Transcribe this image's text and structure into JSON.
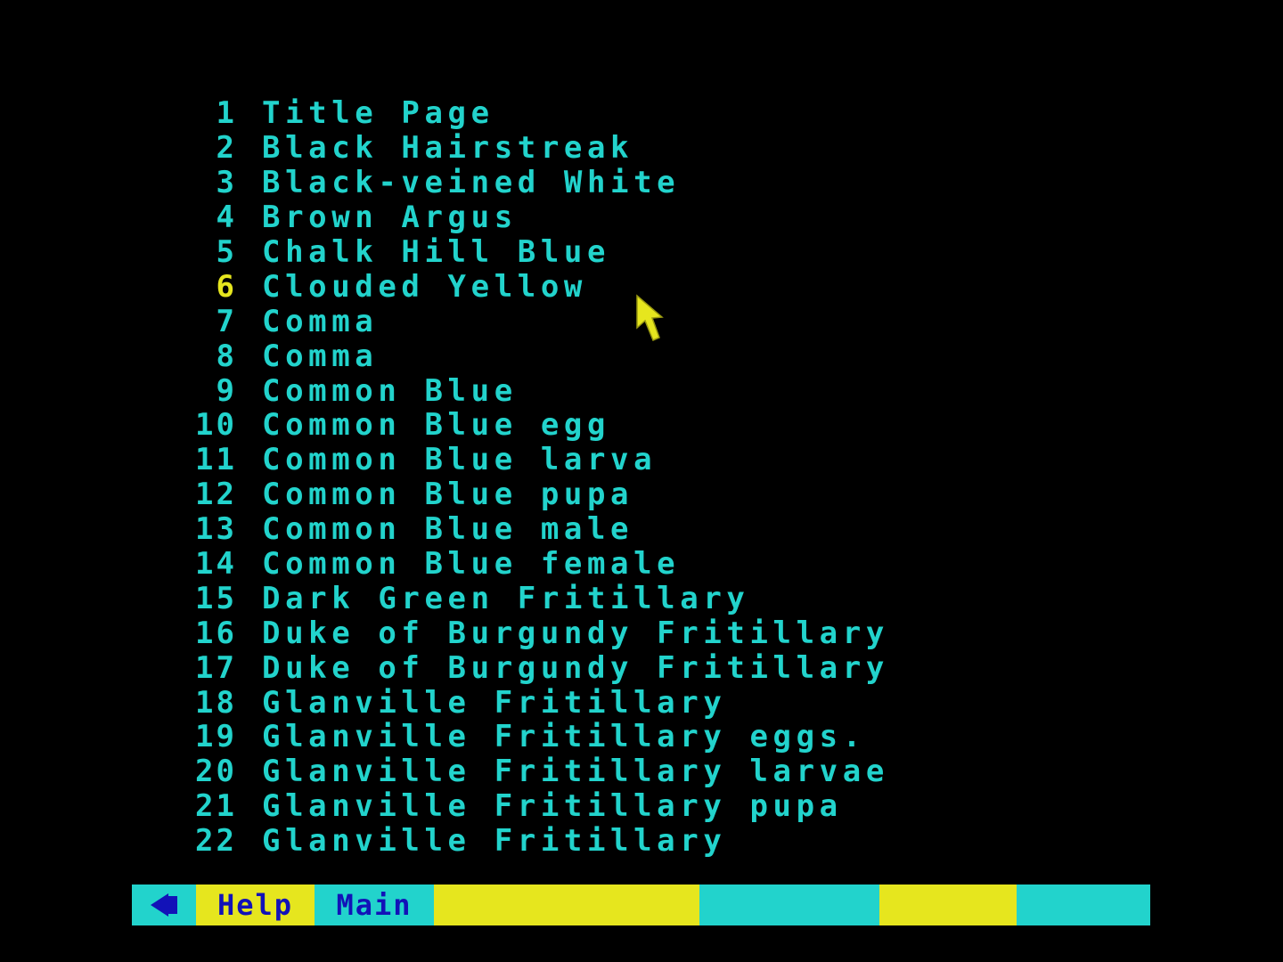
{
  "colors": {
    "background": "#000000",
    "text": "#22d3cc",
    "highlight": "#e6e61e",
    "bar_cyan": "#22d3cc",
    "bar_yellow": "#e6e61e",
    "bar_text": "#1212b8"
  },
  "list": {
    "current_index": 5,
    "items": [
      {
        "num": "1",
        "label": "Title Page"
      },
      {
        "num": "2",
        "label": "Black Hairstreak"
      },
      {
        "num": "3",
        "label": "Black-veined White"
      },
      {
        "num": "4",
        "label": "Brown Argus"
      },
      {
        "num": "5",
        "label": "Chalk Hill Blue"
      },
      {
        "num": "6",
        "label": "Clouded Yellow"
      },
      {
        "num": "7",
        "label": "Comma"
      },
      {
        "num": "8",
        "label": "Comma"
      },
      {
        "num": "9",
        "label": "Common Blue"
      },
      {
        "num": "10",
        "label": "Common Blue egg"
      },
      {
        "num": "11",
        "label": "Common Blue larva"
      },
      {
        "num": "12",
        "label": "Common Blue pupa"
      },
      {
        "num": "13",
        "label": "Common Blue male"
      },
      {
        "num": "14",
        "label": "Common Blue female"
      },
      {
        "num": "15",
        "label": "Dark Green Fritillary"
      },
      {
        "num": "16",
        "label": "Duke of Burgundy Fritillary"
      },
      {
        "num": "17",
        "label": "Duke of Burgundy Fritillary"
      },
      {
        "num": "18",
        "label": "Glanville Fritillary"
      },
      {
        "num": "19",
        "label": "Glanville Fritillary eggs."
      },
      {
        "num": "20",
        "label": "Glanville Fritillary larvae"
      },
      {
        "num": "21",
        "label": "Glanville Fritillary pupa"
      },
      {
        "num": "22",
        "label": "Glanville Fritillary"
      }
    ]
  },
  "bottom_bar": {
    "back_icon": "left-arrow-icon",
    "help_label": "Help",
    "main_label": "Main"
  },
  "pointer": {
    "icon": "mouse-pointer-icon"
  }
}
